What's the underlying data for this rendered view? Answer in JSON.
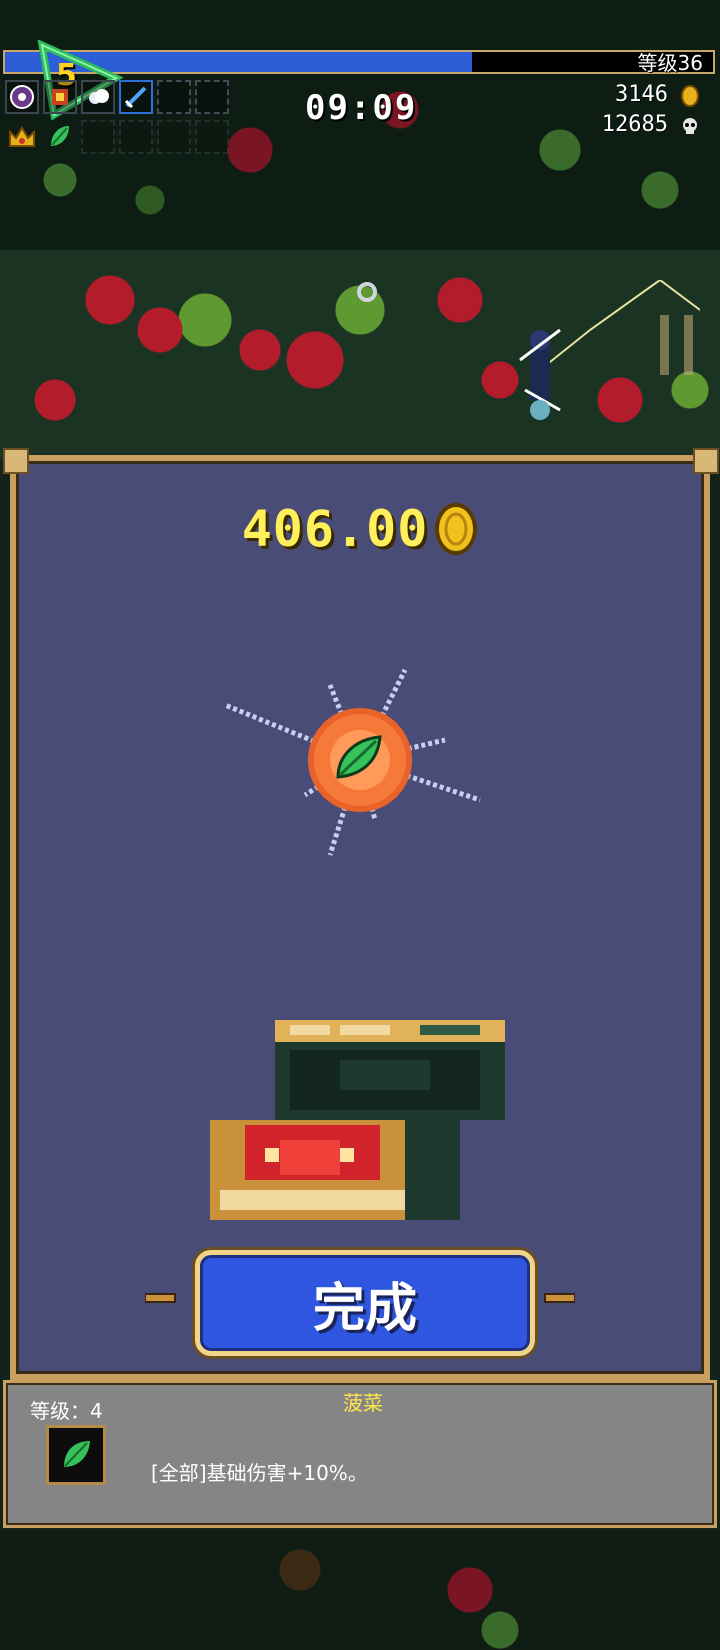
{
  "hud": {
    "xp_progress": 0.66,
    "level_label": "等级36",
    "badge_number": "5",
    "timer": "09:09",
    "gold_count": "3146",
    "kill_count": "12685",
    "weapon_slots": [
      "magic-circle-icon",
      "fire-wand-icon",
      "cloud-icon",
      "blue-sword-icon",
      "empty",
      "empty"
    ],
    "passive_slots": [
      "crown-icon",
      "spinach-icon",
      "empty",
      "empty",
      "empty",
      "empty"
    ]
  },
  "chest_screen": {
    "gold_reward": "406.00",
    "reward_item_icon": "spinach-icon",
    "done_button": "完成"
  },
  "item_info": {
    "level_text": "等级：4",
    "name": "菠菜",
    "description": "[全部]基础伤害+10%。"
  },
  "colors": {
    "xp_fill": "#2d5ed8",
    "panel_bg": "#4a4c78",
    "panel_border": "#c9a060",
    "button": "#2f56e0",
    "gold_text": "#ffef5a",
    "item_name": "#ffe74a"
  }
}
